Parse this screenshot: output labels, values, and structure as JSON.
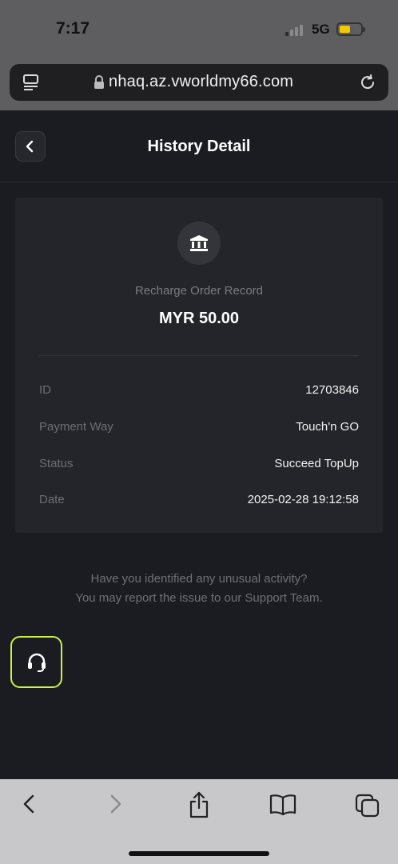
{
  "status_bar": {
    "time": "7:17",
    "network": "5G",
    "battery_level": 0.4,
    "battery_color": "#f5c900"
  },
  "browser": {
    "url": "nhaq.az.vworldmy66.com",
    "icons": [
      "tabs-overview-icon",
      "lock-icon",
      "reload-icon"
    ]
  },
  "header": {
    "title": "History Detail",
    "back_icon": "chevron-left-icon"
  },
  "record": {
    "icon": "bank-icon",
    "type": "Recharge Order Record",
    "amount": "MYR 50.00",
    "details": [
      {
        "label": "ID",
        "value": "12703846"
      },
      {
        "label": "Payment Way",
        "value": "Touch'n GO"
      },
      {
        "label": "Status",
        "value": "Succeed TopUp"
      },
      {
        "label": "Date",
        "value": "2025-02-28 19:12:58"
      }
    ]
  },
  "notice": {
    "line1": "Have you identified any unusual activity?",
    "line2": "You may report the issue to our Support Team."
  },
  "support": {
    "icon": "headset-icon",
    "accent": "#c9f04b"
  },
  "toolbar": {
    "icons": [
      "back-arrow-icon",
      "forward-arrow-icon",
      "share-icon",
      "bookmarks-icon",
      "tabs-icon"
    ]
  }
}
